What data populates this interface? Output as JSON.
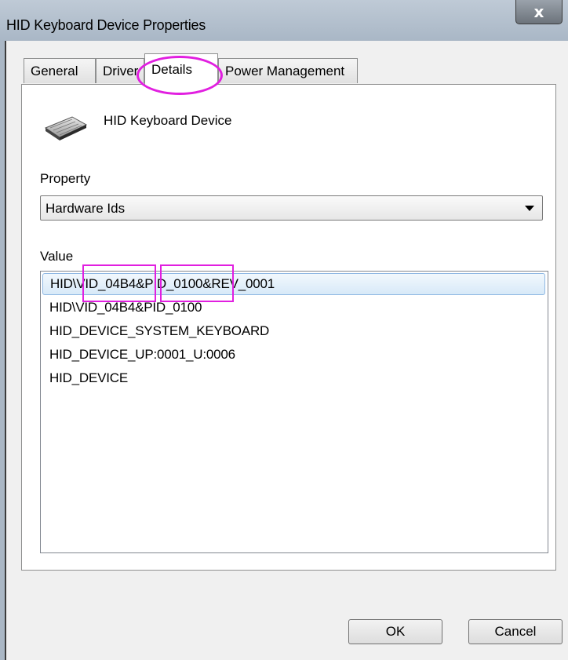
{
  "window": {
    "title": "HID Keyboard Device Properties",
    "close_label": "x"
  },
  "tabs": [
    {
      "label": "General",
      "active": false
    },
    {
      "label": "Driver",
      "active": false
    },
    {
      "label": "Details",
      "active": true
    },
    {
      "label": "Power Management",
      "active": false
    }
  ],
  "device": {
    "name": "HID Keyboard Device",
    "icon": "keyboard-icon"
  },
  "property": {
    "label": "Property",
    "selected": "Hardware Ids"
  },
  "value": {
    "label": "Value",
    "items": [
      "HID\\VID_04B4&PID_0100&REV_0001",
      "HID\\VID_04B4&PID_0100",
      "HID_DEVICE_SYSTEM_KEYBOARD",
      "HID_DEVICE_UP:0001_U:0006",
      "HID_DEVICE"
    ],
    "selected_index": 0
  },
  "buttons": {
    "ok": "OK",
    "cancel": "Cancel"
  },
  "colors": {
    "highlight": "#e11fe0",
    "selection": "#d7e9f8",
    "titlebar": "#b3c0ce"
  }
}
